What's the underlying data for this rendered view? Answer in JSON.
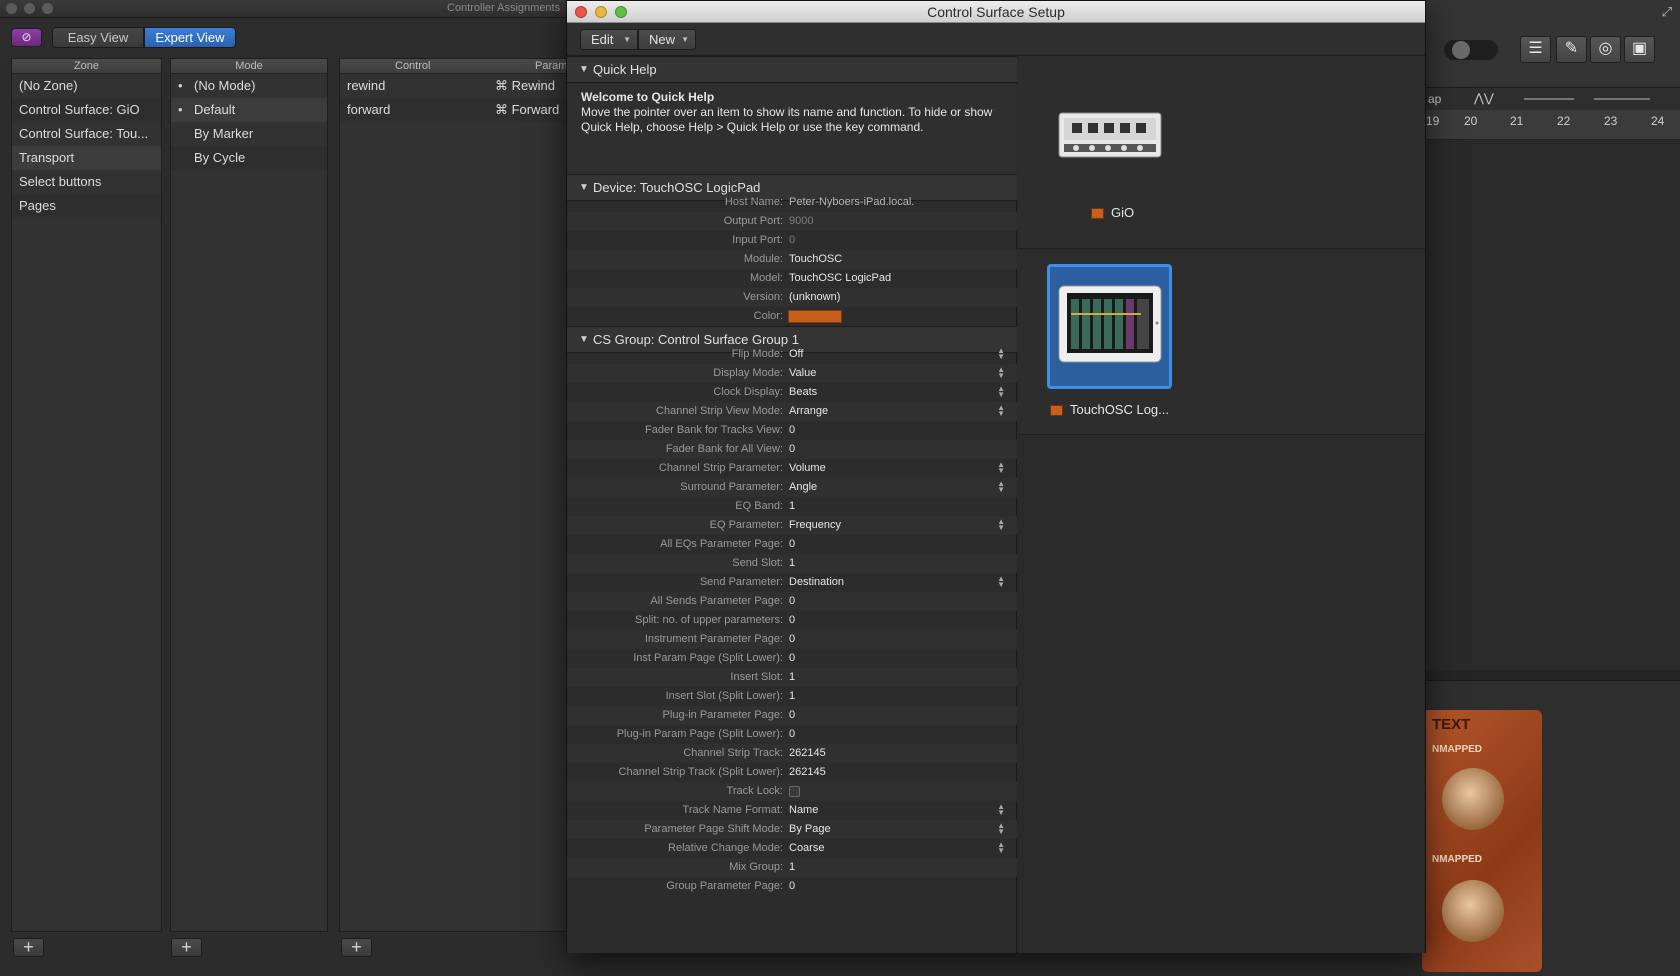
{
  "controller_window": {
    "title": "Controller Assignments",
    "link_icon": "link-icon",
    "views": {
      "easy": "Easy View",
      "expert": "Expert View"
    },
    "columns": {
      "zone": "Zone",
      "mode": "Mode",
      "control": "Control",
      "param": "Param"
    },
    "zones": [
      "(No Zone)",
      "Control Surface: GiO",
      "Control Surface: Tou...",
      "Transport",
      "Select buttons",
      "Pages"
    ],
    "modes": [
      "(No Mode)",
      "Default",
      "By Marker",
      "By Cycle"
    ],
    "mode_bullets": [
      "•",
      "•"
    ],
    "controls": [
      {
        "name": "rewind",
        "param": "⌘ Rewind"
      },
      {
        "name": "forward",
        "param": "⌘ Forward"
      }
    ],
    "add_label": "+"
  },
  "logic_bg": {
    "ruler": [
      "19",
      "20",
      "21",
      "22",
      "23",
      "24"
    ],
    "snap_label": "ap",
    "text_label": "TEXT",
    "unmapped_1": "NMAPPED",
    "unmapped_2": "NMAPPED",
    "toolbar_icons": [
      "list-icon",
      "notepad-icon",
      "loop-browser-icon",
      "media-icon"
    ]
  },
  "dialog": {
    "title": "Control Surface Setup",
    "menus": {
      "edit": "Edit",
      "new": "New"
    },
    "quick_help": {
      "heading": "Quick Help",
      "welcome": "Welcome to Quick Help",
      "body": "Move the pointer over an item to show its name and function. To hide or show Quick Help, choose Help > Quick Help or use the key command."
    },
    "device": {
      "heading": "Device:  TouchOSC LogicPad",
      "rows": [
        {
          "label": "Host Name:",
          "value": "Peter-Nyboers-iPad.local."
        },
        {
          "label": "Output Port:",
          "value": "9000"
        },
        {
          "label": "Input Port:",
          "value": "0"
        },
        {
          "label": "Module:",
          "value": "TouchOSC"
        },
        {
          "label": "Model:",
          "value": "TouchOSC LogicPad"
        },
        {
          "label": "Version:",
          "value": "(unknown)"
        },
        {
          "label": "Color:",
          "value": ""
        }
      ],
      "color": "#c8601c"
    },
    "cs_group": {
      "heading": "CS Group:  Control Surface Group 1",
      "rows": [
        {
          "label": "Flip Mode:",
          "value": "Off"
        },
        {
          "label": "Display Mode:",
          "value": "Value"
        },
        {
          "label": "Clock Display:",
          "value": "Beats"
        },
        {
          "label": "Channel Strip View Mode:",
          "value": "Arrange"
        },
        {
          "label": "Fader Bank for Tracks View:",
          "value": "0"
        },
        {
          "label": "Fader Bank for All View:",
          "value": "0"
        },
        {
          "label": "Channel Strip Parameter:",
          "value": "Volume"
        },
        {
          "label": "Surround Parameter:",
          "value": "Angle"
        },
        {
          "label": "EQ Band:",
          "value": "1"
        },
        {
          "label": "EQ Parameter:",
          "value": "Frequency"
        },
        {
          "label": "All EQs Parameter Page:",
          "value": "0"
        },
        {
          "label": "Send Slot:",
          "value": "1"
        },
        {
          "label": "Send Parameter:",
          "value": "Destination"
        },
        {
          "label": "All Sends Parameter Page:",
          "value": "0"
        },
        {
          "label": "Split: no. of upper parameters:",
          "value": "0"
        },
        {
          "label": "Instrument Parameter Page:",
          "value": "0"
        },
        {
          "label": "Inst Param Page (Split Lower):",
          "value": "0"
        },
        {
          "label": "Insert Slot:",
          "value": "1"
        },
        {
          "label": "Insert Slot (Split Lower):",
          "value": "1"
        },
        {
          "label": "Plug-in Parameter Page:",
          "value": "0"
        },
        {
          "label": "Plug-in Param Page (Split Lower):",
          "value": "0"
        },
        {
          "label": "Channel Strip Track:",
          "value": "262145"
        },
        {
          "label": "Channel Strip Track (Split Lower):",
          "value": "262145"
        },
        {
          "label": "Track Lock:",
          "value": ""
        },
        {
          "label": "Track Name Format:",
          "value": "Name"
        },
        {
          "label": "Parameter Page Shift Mode:",
          "value": "By Page"
        },
        {
          "label": "Relative Change Mode:",
          "value": "Coarse"
        },
        {
          "label": "Mix Group:",
          "value": "1"
        },
        {
          "label": "Group Parameter Page:",
          "value": "0"
        }
      ]
    },
    "devices": [
      {
        "name": "GiO",
        "color": "#c8601c"
      },
      {
        "name": "TouchOSC Log...",
        "color": "#c8601c"
      }
    ]
  }
}
